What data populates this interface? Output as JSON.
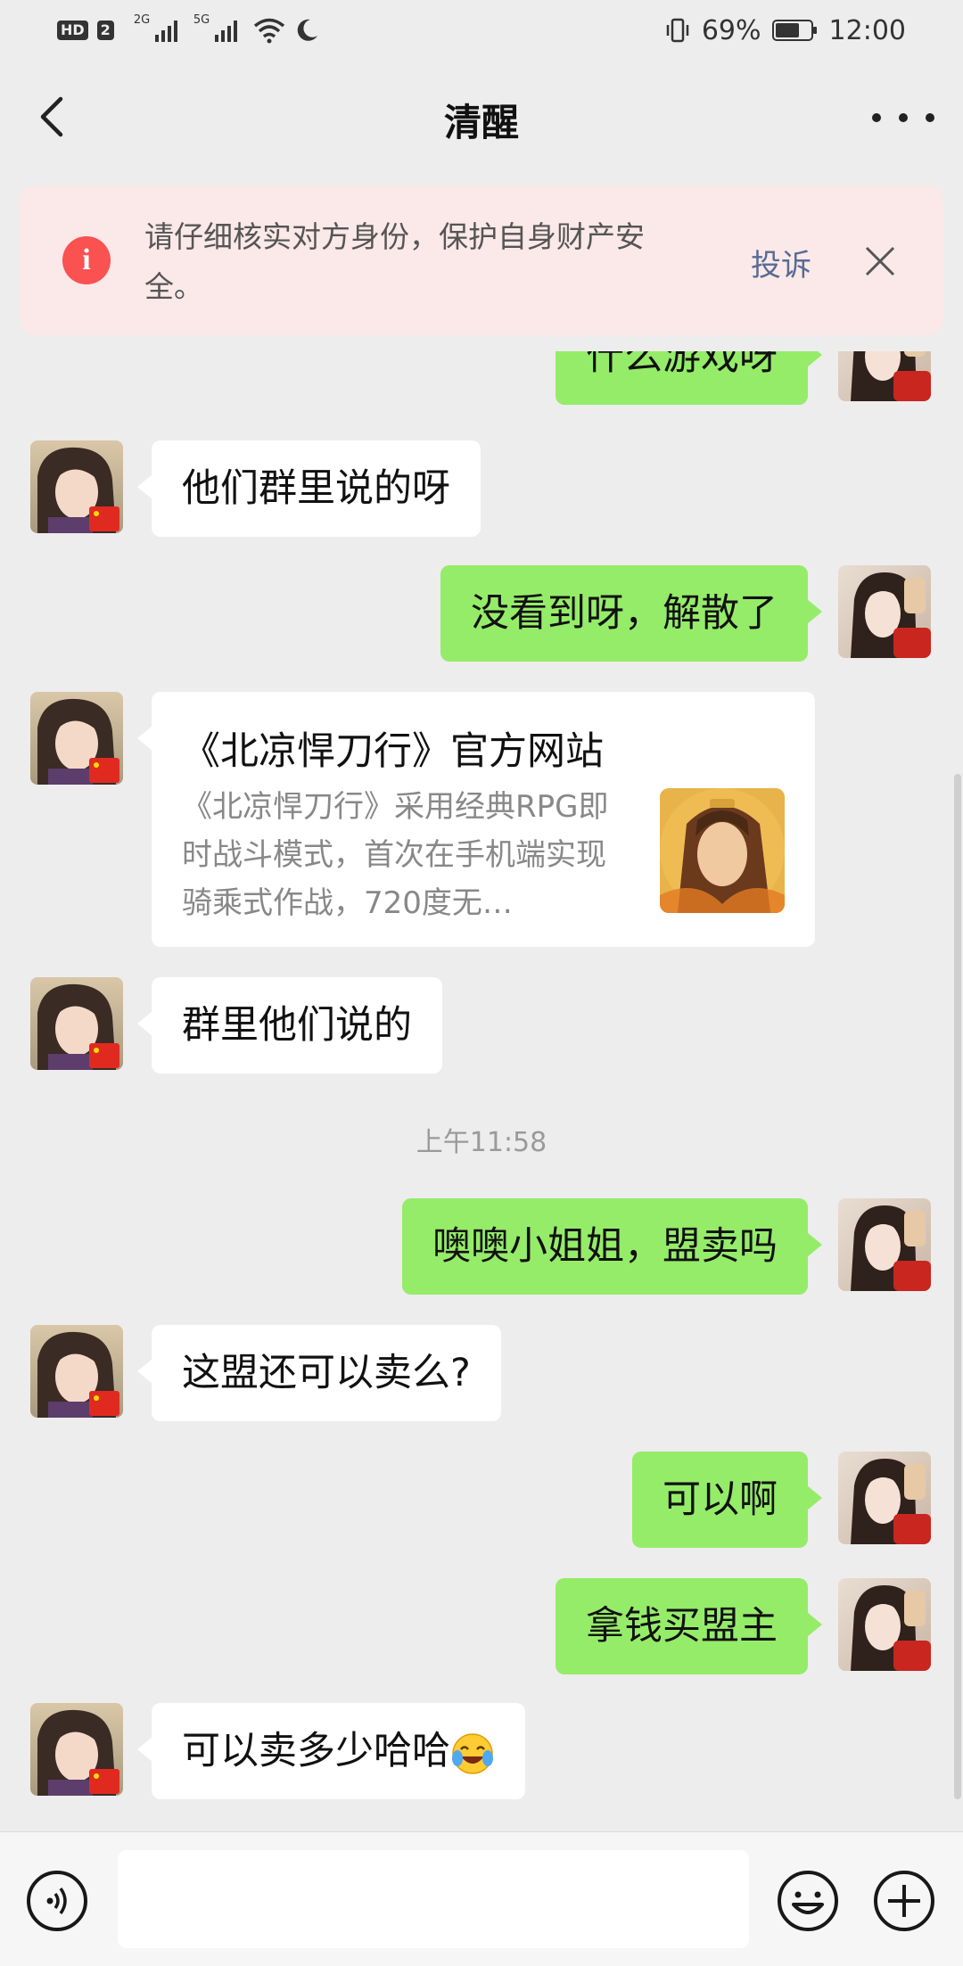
{
  "status_bar": {
    "left_badge_hd": "HD",
    "left_badge_num": "2",
    "signal1_label": "2G",
    "signal2_label": "5G",
    "battery_level_percent": 69,
    "battery": "69%",
    "time": "12:00"
  },
  "header": {
    "title": "清醒",
    "back_icon": "chevron-left-icon",
    "more_icon": "more-dots-icon"
  },
  "warning": {
    "text": "请仔细核实对方身份，保护自身财产安全。",
    "action": "投诉",
    "icon": "info-alert-icon",
    "color": "#fa5151"
  },
  "colors": {
    "outgoing_bubble": "#95ec69",
    "incoming_bubble": "#ffffff",
    "background": "#ededed",
    "link": "#576b95"
  },
  "messages": [
    {
      "dir": "out",
      "text": "什么游戏呀"
    },
    {
      "dir": "in",
      "text": "他们群里说的呀"
    },
    {
      "dir": "out",
      "text": "没看到呀，解散了"
    },
    {
      "dir": "in",
      "type": "link_card",
      "title": "《北凉悍刀行》官方网站",
      "desc": "《北凉悍刀行》采用经典RPG即时战斗模式，首次在手机端实现骑乘式作战，720度无…"
    },
    {
      "dir": "in",
      "text": "群里他们说的"
    },
    {
      "type": "timestamp",
      "text": "上午11:58"
    },
    {
      "dir": "out",
      "text": "噢噢小姐姐，盟卖吗"
    },
    {
      "dir": "in",
      "text": "这盟还可以卖么?"
    },
    {
      "dir": "out",
      "text": "可以啊"
    },
    {
      "dir": "out",
      "text": "拿钱买盟主"
    },
    {
      "dir": "in",
      "text": "可以卖多少哈哈",
      "emoji": "laughing-tears-emoji"
    }
  ],
  "input_bar": {
    "voice_icon": "voice-icon",
    "emoji_icon": "smiley-icon",
    "plus_icon": "plus-icon",
    "value": ""
  }
}
